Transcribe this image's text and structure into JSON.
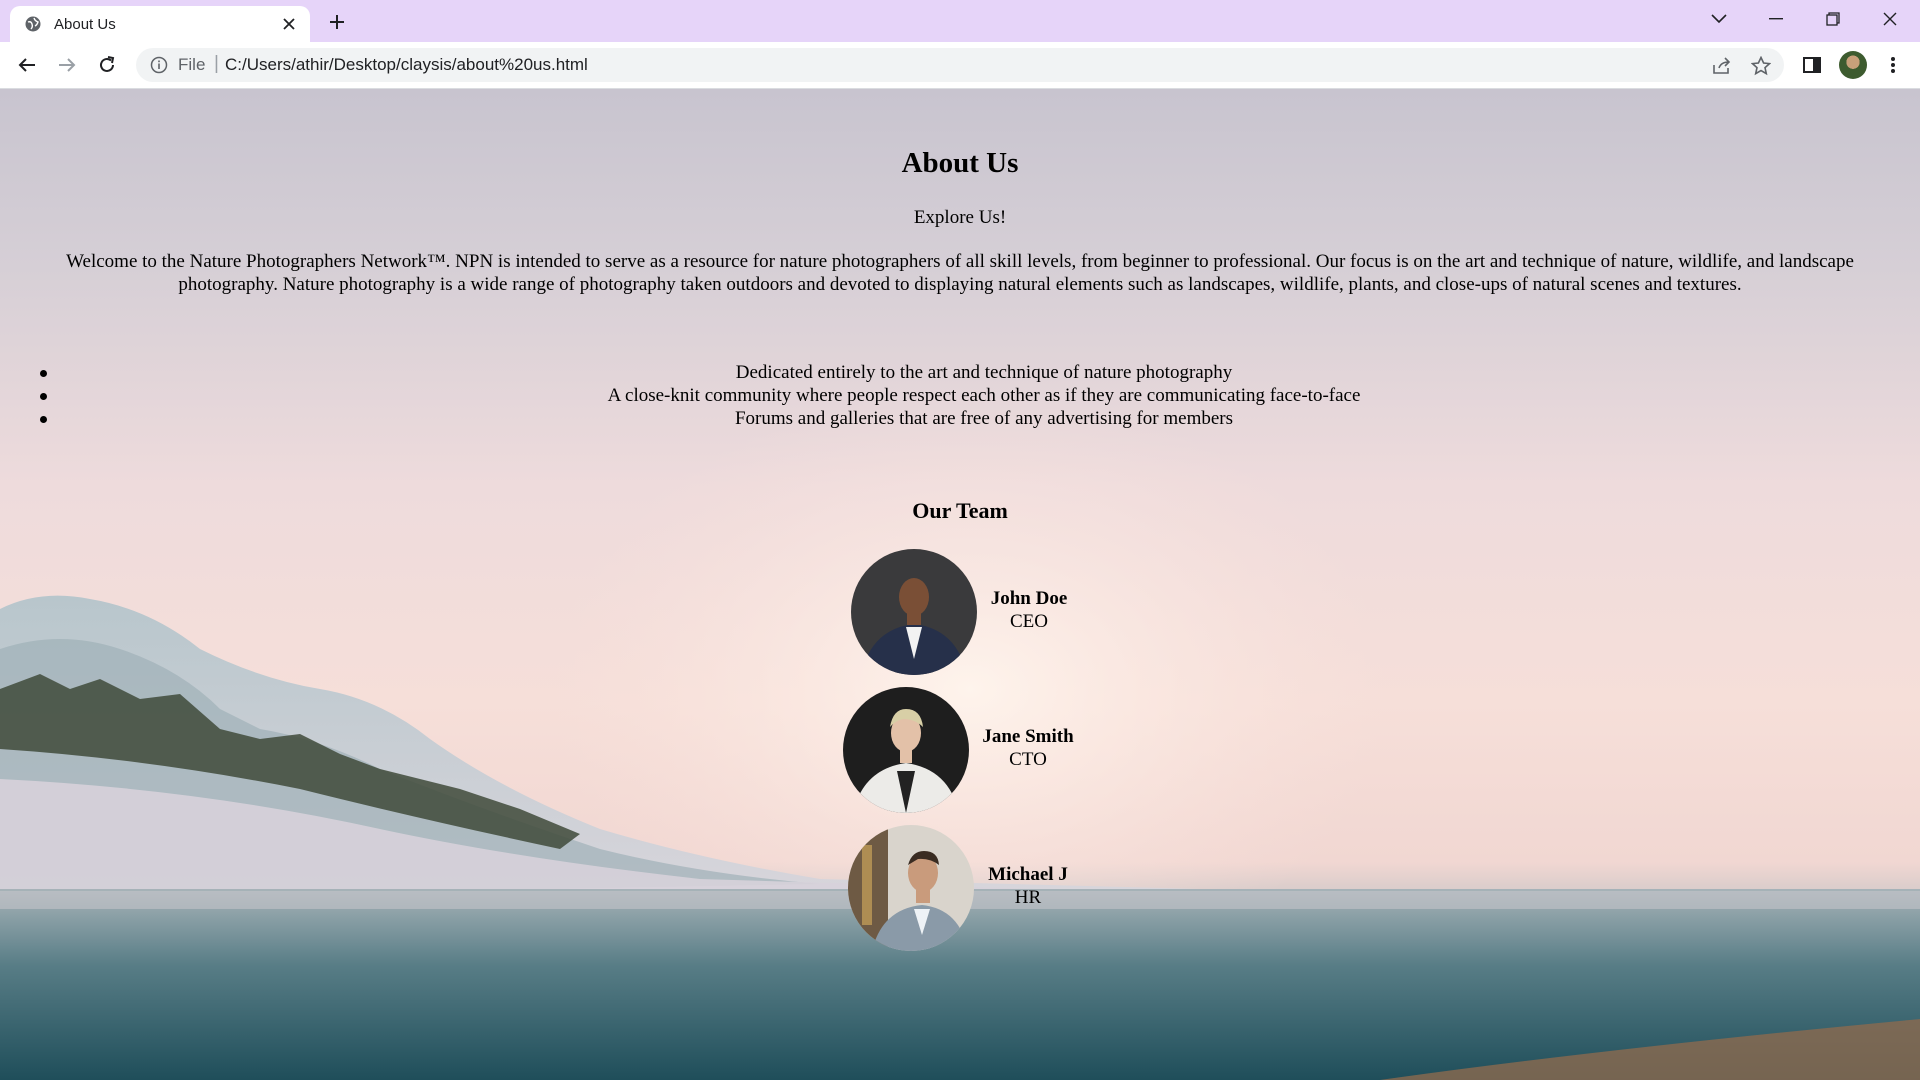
{
  "browser": {
    "tab_title": "About Us",
    "address_scheme": "File",
    "address_url": "C:/Users/athir/Desktop/claysis/about%20us.html"
  },
  "page": {
    "title": "About Us",
    "subtitle": "Explore Us!",
    "intro": "Welcome to the Nature Photographers Network™. NPN is intended to serve as a resource for nature photographers of all skill levels, from beginner to professional. Our focus is on the art and technique of nature, wildlife, and landscape photography. Nature photography is a wide range of photography taken outdoors and devoted to displaying natural elements such as landscapes, wildlife, plants, and close-ups of natural scenes and textures.",
    "features": [
      "Dedicated entirely to the art and technique of nature photography",
      "A close-knit community where people respect each other as if they are communicating face-to-face",
      "Forums and galleries that are free of any advertising for members"
    ],
    "team_heading": "Our Team",
    "team": [
      {
        "name": "John Doe",
        "role": "CEO"
      },
      {
        "name": "Jane Smith",
        "role": "CTO"
      },
      {
        "name": "Michael J",
        "role": "HR"
      }
    ]
  },
  "colors": {
    "tabbar": "#e6d4f9",
    "text": "#000000"
  }
}
